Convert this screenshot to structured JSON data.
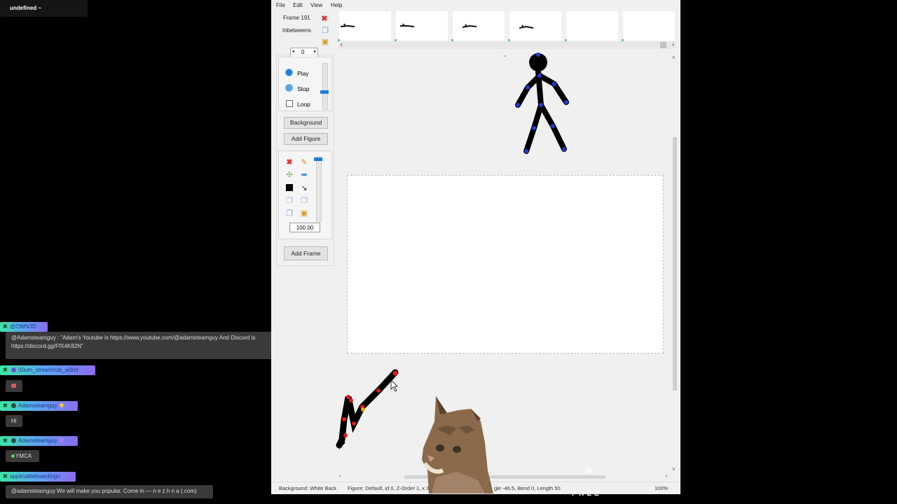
{
  "overlay": {
    "top_badge": "undefined ~",
    "free_label": "FREE"
  },
  "chat": [
    {
      "user": "@OWN3D",
      "message": "@Adamsteamguy : \"Adam's Youtube is https://www.youtube.com/@adamsteamguy And Discord is https://discord.gg/FfX4K82N\""
    },
    {
      "user": "00um_streamhub_w0rld",
      "message": ""
    },
    {
      "user": "Adamsteamguy",
      "message": "Hi"
    },
    {
      "user": "Adamsteamguy",
      "message": "YMCA"
    },
    {
      "user": "applicablehoardingn",
      "message": "@adamsteamguy We will make you popular. Come in — n e z h n a (.com)"
    }
  ],
  "menu": [
    "File",
    "Edit",
    "View",
    "Help"
  ],
  "frame_panel": {
    "frame_label": "Frame 191",
    "inbetweens_label": "Inbetweens",
    "inbetweens_value": "0"
  },
  "controls": {
    "play": "Play",
    "stop": "Stop",
    "loop": "Loop",
    "background": "Background",
    "add_figure": "Add Figure",
    "scale_value": "100.00",
    "add_frame": "Add Frame"
  },
  "status": {
    "background": "Background: White Back",
    "figure": "Figure: Default,  id 0,  Z-Order 1,  x 3",
    "segment": "gle -46.5,  Bend 0,  Length 50",
    "zoom": "100%"
  },
  "colors": {
    "accent": "#1b7fd6",
    "joint_blue": "#1f3bd6",
    "joint_red": "#e01a1a",
    "chip_green": "#3ee6a8",
    "chip_purple": "#8a6cf0"
  }
}
